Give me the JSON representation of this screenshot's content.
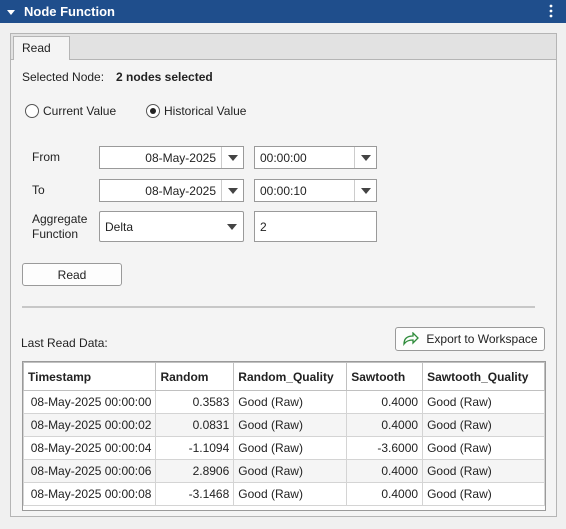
{
  "header": {
    "title": "Node Function"
  },
  "tabs": [
    {
      "label": "Read"
    }
  ],
  "selected_node": {
    "label": "Selected Node:",
    "value": "2 nodes selected"
  },
  "mode": {
    "current_label": "Current Value",
    "historical_label": "Historical Value",
    "selected": "historical"
  },
  "from": {
    "label": "From",
    "date": "08-May-2025",
    "time": "00:00:00"
  },
  "to": {
    "label": "To",
    "date": "08-May-2025",
    "time": "00:00:10"
  },
  "aggregate": {
    "label_line1": "Aggregate",
    "label_line2": "Function",
    "value": "Delta",
    "interval": "2"
  },
  "read_button": "Read",
  "last_read": {
    "label": "Last Read Data:",
    "export_label": "Export to Workspace"
  },
  "table": {
    "columns": [
      "Timestamp",
      "Random",
      "Random_Quality",
      "Sawtooth",
      "Sawtooth_Quality"
    ],
    "rows": [
      [
        "08-May-2025 00:00:00",
        "0.3583",
        "Good (Raw)",
        "0.4000",
        "Good (Raw)"
      ],
      [
        "08-May-2025 00:00:02",
        "0.0831",
        "Good (Raw)",
        "0.4000",
        "Good (Raw)"
      ],
      [
        "08-May-2025 00:00:04",
        "-1.1094",
        "Good (Raw)",
        "-3.6000",
        "Good (Raw)"
      ],
      [
        "08-May-2025 00:00:06",
        "2.8906",
        "Good (Raw)",
        "0.4000",
        "Good (Raw)"
      ],
      [
        "08-May-2025 00:00:08",
        "-3.1468",
        "Good (Raw)",
        "0.4000",
        "Good (Raw)"
      ]
    ]
  },
  "colors": {
    "titlebar": "#1f4e8c",
    "export_icon": "#2e8b3a"
  }
}
